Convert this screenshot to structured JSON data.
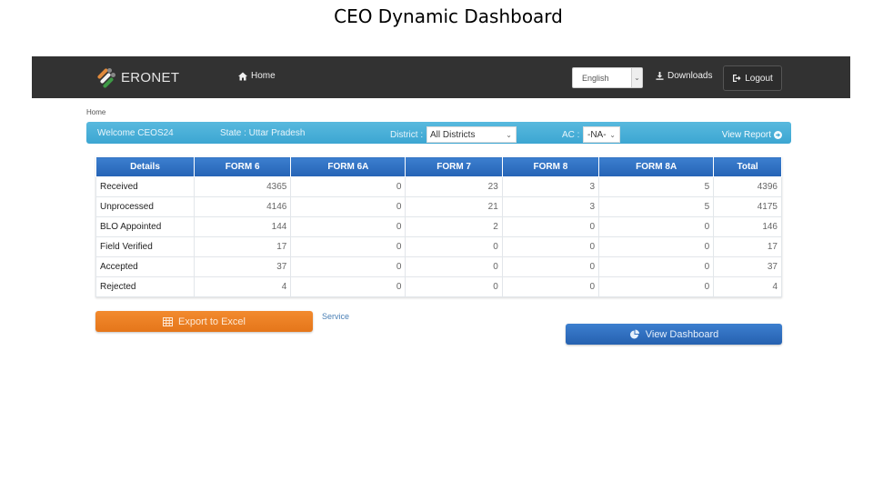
{
  "slide": {
    "title": "CEO Dynamic Dashboard"
  },
  "navbar": {
    "brand": "ERONET",
    "home_label": "Home",
    "language_selected": "English",
    "downloads_label": "Downloads",
    "logout_label": "Logout"
  },
  "breadcrumb": {
    "current": "Home"
  },
  "info_bar": {
    "welcome": "Welcome CEOS24",
    "state": "State : Uttar Pradesh",
    "district_label": "District :",
    "district_selected": "All Districts",
    "ac_label": "AC :",
    "ac_selected": "-NA-",
    "view_report_label": "View Report"
  },
  "table": {
    "headers": [
      "Details",
      "FORM 6",
      "FORM 6A",
      "FORM 7",
      "FORM 8",
      "FORM 8A",
      "Total"
    ],
    "rows": [
      [
        "Received",
        "4365",
        "0",
        "23",
        "3",
        "5",
        "4396"
      ],
      [
        "Unprocessed",
        "4146",
        "0",
        "21",
        "3",
        "5",
        "4175"
      ],
      [
        "BLO Appointed",
        "144",
        "0",
        "2",
        "0",
        "0",
        "146"
      ],
      [
        "Field Verified",
        "17",
        "0",
        "0",
        "0",
        "0",
        "17"
      ],
      [
        "Accepted",
        "37",
        "0",
        "0",
        "0",
        "0",
        "37"
      ],
      [
        "Rejected",
        "4",
        "0",
        "0",
        "0",
        "0",
        "4"
      ]
    ]
  },
  "actions": {
    "export_label": "Export to Excel",
    "service_label": "Service",
    "dashboard_label": "View Dashboard"
  },
  "colors": {
    "navbar_bg": "#323232",
    "info_bar": "#4ab0d8",
    "table_header": "#2e6fc2",
    "export_button": "#ee8226",
    "dashboard_button": "#316fc0"
  }
}
